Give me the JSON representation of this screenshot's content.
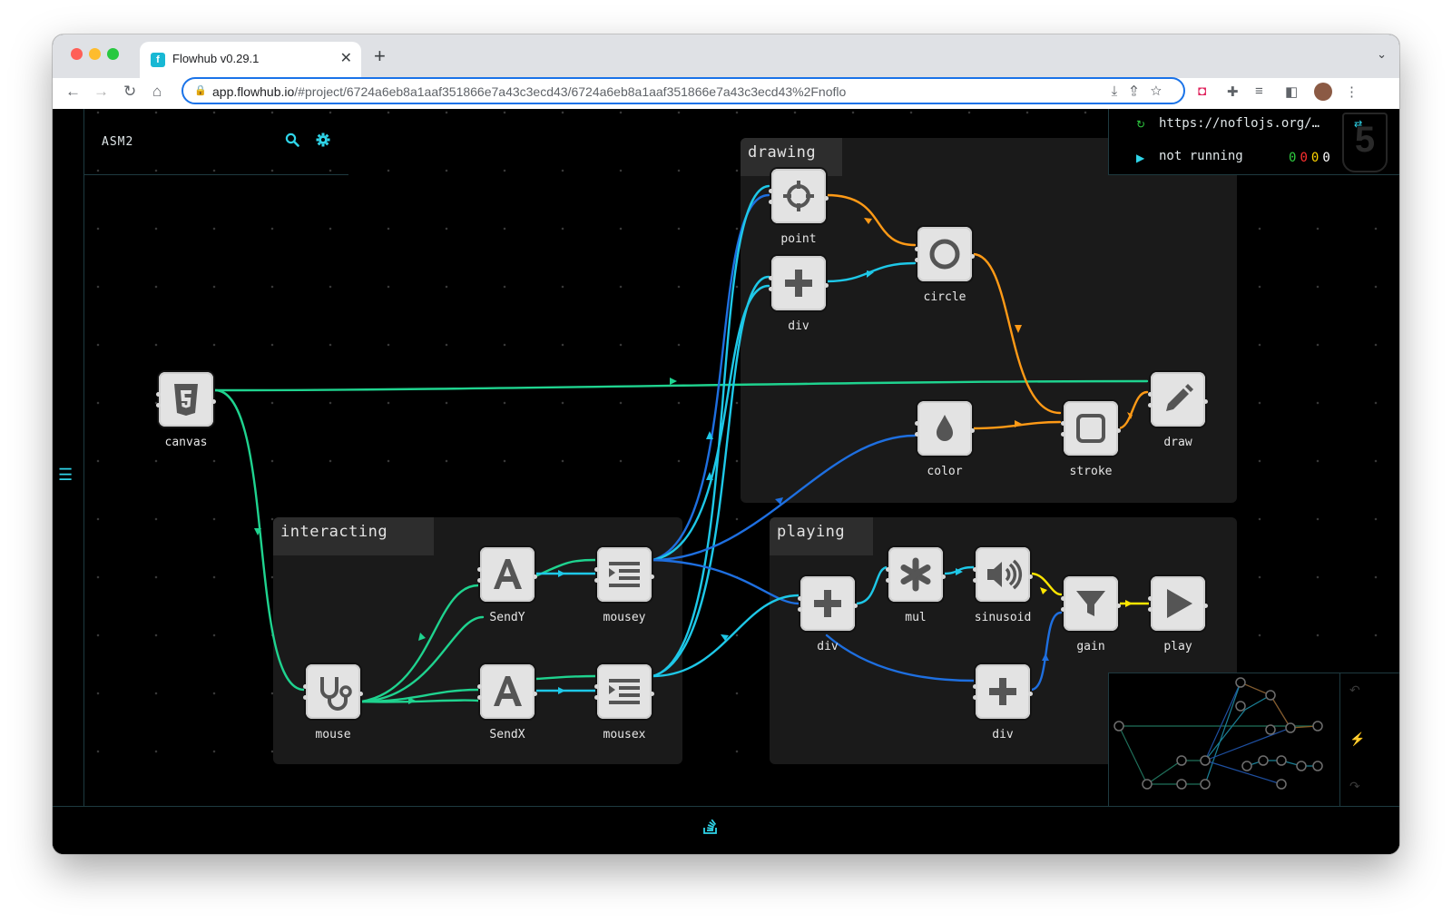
{
  "browser": {
    "tab_title": "Flowhub v0.29.1",
    "tab_favicon": "f",
    "url_host": "app.flowhub.io",
    "url_path": "/#project/6724a6eb8a1aaf351866e7a43c3ecd43/6724a6eb8a1aaf351866e7a43c3ecd43%2Fnoflo"
  },
  "project": {
    "name": "ASM2"
  },
  "runtime": {
    "url": "https://noflojs.org/…",
    "status": "not running",
    "counts": [
      "0",
      "0",
      "0",
      "0"
    ],
    "count_colors": [
      "#2ecc40",
      "#ff3030",
      "#ffd400",
      "#ffffff"
    ]
  },
  "groups": [
    {
      "id": "drawing",
      "label": "drawing"
    },
    {
      "id": "interacting",
      "label": "interacting"
    },
    {
      "id": "playing",
      "label": "playing"
    }
  ],
  "nodes": [
    {
      "id": "canvas",
      "label": "canvas",
      "icon": "html5-icon"
    },
    {
      "id": "point",
      "label": "point",
      "icon": "crosshairs-icon"
    },
    {
      "id": "div1",
      "label": "div",
      "icon": "plus-icon"
    },
    {
      "id": "circle",
      "label": "circle",
      "icon": "circle-icon"
    },
    {
      "id": "color",
      "label": "color",
      "icon": "tint-icon"
    },
    {
      "id": "stroke",
      "label": "stroke",
      "icon": "square-icon"
    },
    {
      "id": "draw",
      "label": "draw",
      "icon": "pencil-icon"
    },
    {
      "id": "mouse",
      "label": "mouse",
      "icon": "stethoscope-icon"
    },
    {
      "id": "sendy",
      "label": "SendY",
      "icon": "font-icon"
    },
    {
      "id": "sendx",
      "label": "SendX",
      "icon": "font-icon"
    },
    {
      "id": "mousey",
      "label": "mousey",
      "icon": "indent-icon"
    },
    {
      "id": "mousex",
      "label": "mousex",
      "icon": "indent-icon"
    },
    {
      "id": "div2",
      "label": "div",
      "icon": "plus-icon"
    },
    {
      "id": "mul",
      "label": "mul",
      "icon": "asterisk-icon"
    },
    {
      "id": "sinusoid",
      "label": "sinusoid",
      "icon": "volume-up-icon"
    },
    {
      "id": "gain",
      "label": "gain",
      "icon": "filter-icon"
    },
    {
      "id": "play",
      "label": "play",
      "icon": "play-icon"
    },
    {
      "id": "div3",
      "label": "div",
      "icon": "plus-icon"
    }
  ],
  "edge_colors": {
    "green": "#1fd38f",
    "cyan": "#1ec8e8",
    "blue": "#1e6fe0",
    "orange": "#ff9a16",
    "yellow": "#ffe600"
  },
  "theme": {
    "accent": "#2fd5e9",
    "node_fill": "#e3e3e3",
    "group_fill": "#1a1a1a"
  }
}
